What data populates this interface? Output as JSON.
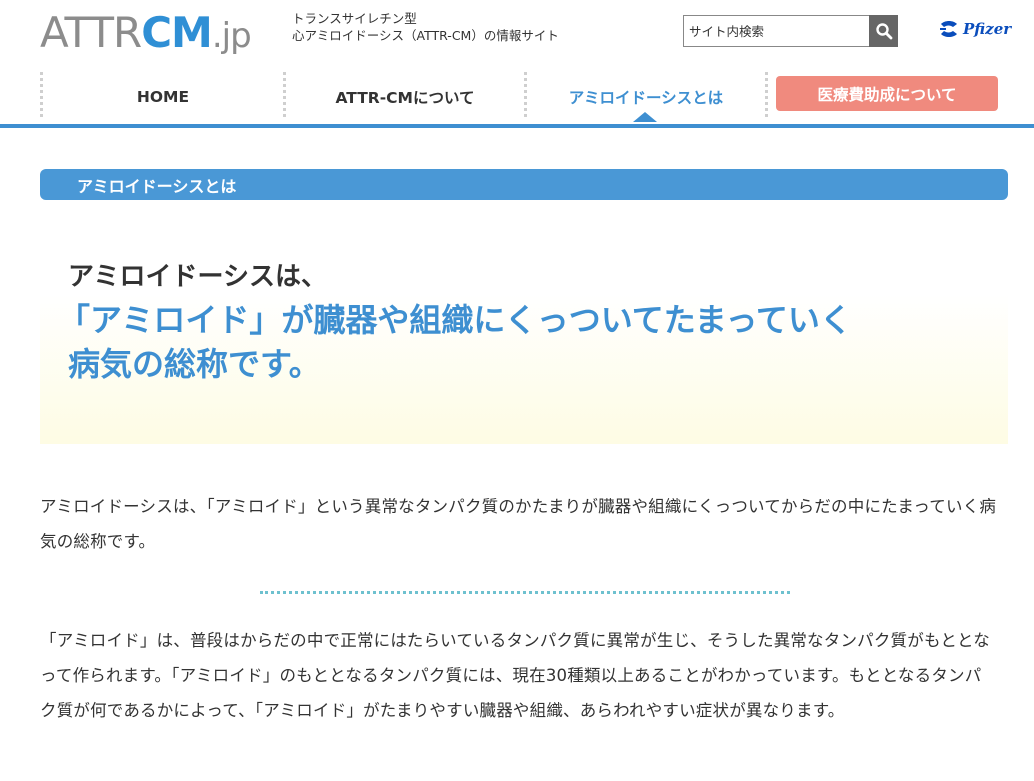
{
  "header": {
    "logo_part1": "ATTR",
    "logo_part2": "CM",
    "logo_part3": ".jp",
    "tagline_line1": "トランスサイレチン型",
    "tagline_line2": "心アミロイドーシス（ATTR-CM）の情報サイト",
    "search_placeholder": "サイト内検索",
    "brand_logo_text": "Pfizer"
  },
  "nav": {
    "items": [
      {
        "label": "HOME"
      },
      {
        "label": "ATTR-CMについて"
      },
      {
        "label": "アミロイドーシスとは"
      },
      {
        "label": "医療費助成について"
      }
    ]
  },
  "section": {
    "heading": "アミロイドーシスとは"
  },
  "hero": {
    "lead": "アミロイドーシスは、",
    "headline_line1": "「アミロイド」が臓器や組織にくっついてたまっていく",
    "headline_line2": "病気の総称です。"
  },
  "body": {
    "para1": "アミロイドーシスは、「アミロイド」という異常なタンパク質のかたまりが臓器や組織にくっついてからだの中にたまっていく病気の総称です。",
    "para2": "「アミロイド」は、普段はからだの中で正常にはたらいているタンパク質に異常が生じ、そうした異常なタンパク質がもととなって作られます。「アミロイド」のもととなるタンパク質には、現在30種類以上あることがわかっています。もととなるタンパク質が何であるかによって、「アミロイド」がたまりやすい臓器や組織、あらわれやすい症状が異なります。"
  },
  "colors": {
    "brand_blue": "#3e8fd1",
    "cta_salmon": "#f08a7e",
    "logo_gray": "#8c8c8c",
    "hero_cream": "#fefce4",
    "divider_teal": "#6ec1cf"
  }
}
